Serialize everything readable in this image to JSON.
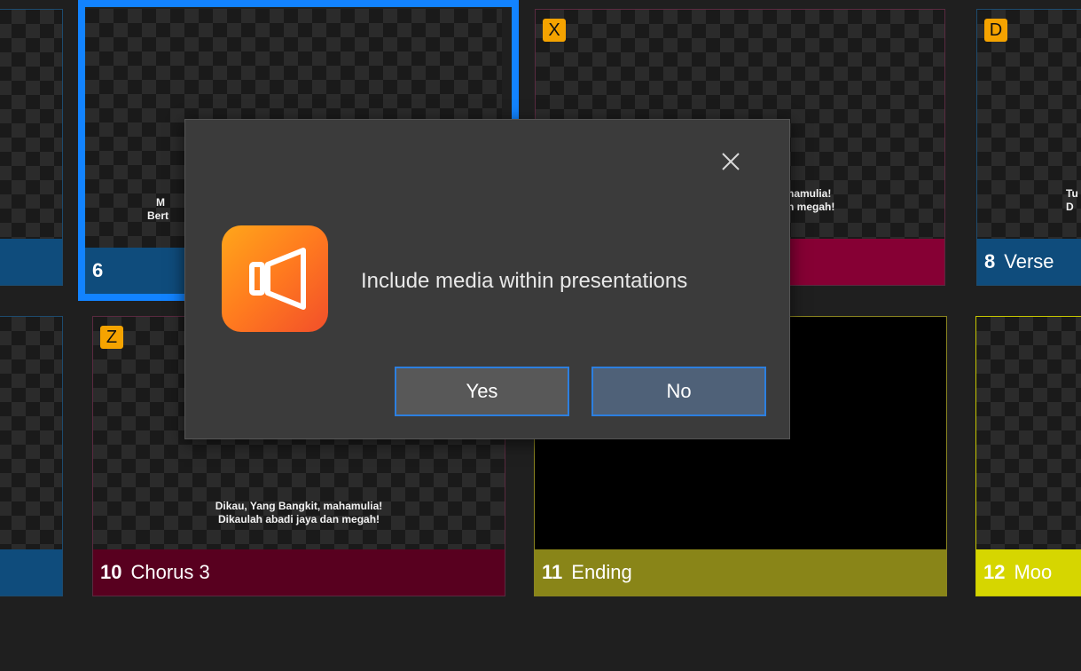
{
  "slides": [
    {
      "id": "left-top",
      "number": "",
      "title": "",
      "badge": "",
      "lyrics": [],
      "bar_color": "#0f4c7c"
    },
    {
      "id": "6",
      "number": "6",
      "title": "",
      "badge": "",
      "lyrics": [
        "M",
        "Bert"
      ],
      "bar_color": "#0f4c7c"
    },
    {
      "id": "7",
      "number": "",
      "title": "",
      "badge": "X",
      "lyrics": [
        "hamulia!",
        "n megah!"
      ],
      "bar_color": "#860034"
    },
    {
      "id": "8",
      "number": "8",
      "title": "Verse",
      "badge": "D",
      "lyrics": [
        "Tu",
        "D"
      ],
      "bar_color": "#0f4c7c"
    },
    {
      "id": "left-bottom",
      "number": "",
      "title": "",
      "badge": "",
      "lyrics": [],
      "bar_color": "#0f4c7c"
    },
    {
      "id": "10",
      "number": "10",
      "title": "Chorus 3",
      "badge": "Z",
      "lyrics": [
        "Dikau, Yang Bangkit, mahamulia!",
        "Dikaulah abadi jaya dan megah!"
      ],
      "bar_color": "#58001f"
    },
    {
      "id": "11",
      "number": "11",
      "title": "Ending",
      "badge": "",
      "lyrics": [],
      "bar_color": "#898518"
    },
    {
      "id": "12",
      "number": "12",
      "title": "Moo",
      "badge": "",
      "lyrics": [],
      "bar_color": "#d6d600"
    }
  ],
  "dialog": {
    "message": "Include media within presentations",
    "yes_label": "Yes",
    "no_label": "No",
    "close_icon": "close-icon",
    "app_icon": "presentation-app-icon"
  }
}
